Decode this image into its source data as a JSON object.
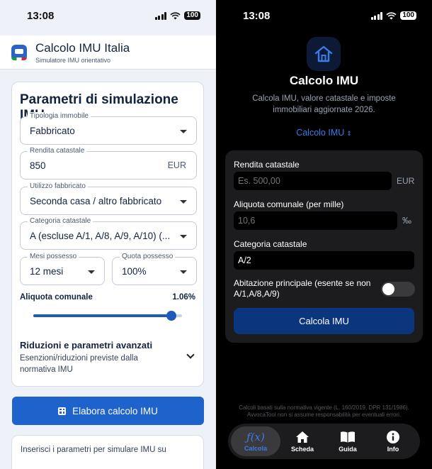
{
  "left": {
    "status": {
      "time": "13:08",
      "battery": "100"
    },
    "app": {
      "title": "Calcolo IMU Italia",
      "subtitle": "Simulatore IMU orientativo"
    },
    "form": {
      "heading": "Parametri di simulazione IMU",
      "tipologia": {
        "label": "Tipologia immobile",
        "value": "Fabbricato"
      },
      "rendita": {
        "label": "Rendita catastale",
        "value": "850",
        "unit": "EUR"
      },
      "utilizzo": {
        "label": "Utilizzo fabbricato",
        "value": "Seconda casa / altro fabbricato"
      },
      "categoria": {
        "label": "Categoria catastale",
        "value": "A (escluse A/1, A/8, A/9, A/10) (..."
      },
      "mesi": {
        "label": "Mesi possesso",
        "value": "12 mesi"
      },
      "quota": {
        "label": "Quota possesso",
        "value": "100%"
      },
      "aliquota": {
        "label": "Aliquota comunale",
        "value": "1.06%",
        "slider_fraction": 0.93
      },
      "riduzioni": {
        "title": "Riduzioni e parametri avanzati",
        "subtitle": "Esenzioni/riduzioni previste dalla normativa IMU"
      }
    },
    "elabora_label": "Elabora calcolo IMU",
    "info_text": "Inserisci i parametri per simulare IMU su"
  },
  "right": {
    "status": {
      "time": "13:08",
      "battery": "100"
    },
    "title": "Calcolo IMU",
    "subtitle": "Calcola IMU, valore catastale e imposte immobiliari aggiornate 2026.",
    "selector": {
      "label": "Calcolo IMU",
      "icon": "⌃⌄"
    },
    "form": {
      "rendita": {
        "label": "Rendita catastale",
        "placeholder": "Es. 500,00",
        "unit": "EUR"
      },
      "aliquota": {
        "label": "Aliquota comunale (per mille)",
        "placeholder": "10,6",
        "unit": "‰"
      },
      "categoria": {
        "label": "Categoria catastale",
        "value": "A/2"
      },
      "abitazione": {
        "label": "Abitazione principale (esente se non A/1,A/8,A/9)",
        "on": false
      }
    },
    "calcola_label": "Calcola IMU",
    "footer": "Calcoli basati sulla normativa vigente (L. 160/2019, DPR 131/1986). AvvocaTool non si assume responsabilità per eventuali errori.",
    "tabs": [
      {
        "label": "Calcola",
        "icon": "function-icon"
      },
      {
        "label": "Scheda",
        "icon": "home-icon"
      },
      {
        "label": "Guida",
        "icon": "book-icon"
      },
      {
        "label": "Info",
        "icon": "info-icon"
      }
    ]
  },
  "colors": {
    "accent": "#1e62cc",
    "dark_accent": "#3d7be8",
    "dark_button": "#0b357d"
  }
}
